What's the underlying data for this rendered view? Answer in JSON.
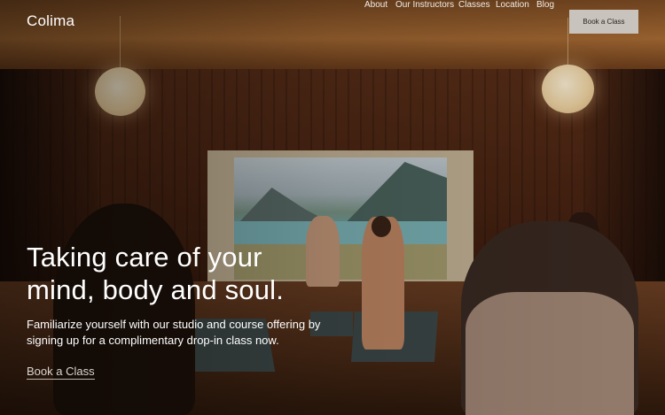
{
  "brand": {
    "logo_text": "Colima"
  },
  "nav": {
    "items": [
      {
        "label": "About"
      },
      {
        "label": "Our Instructors"
      },
      {
        "label": "Classes"
      },
      {
        "label": "Location"
      },
      {
        "label": "Blog"
      }
    ],
    "cta_label": "Book a Class"
  },
  "hero": {
    "headline": "Taking care of your mind, body and soul.",
    "subtext": "Familiarize yourself with our studio and course offering by signing up for a complimentary drop-in class now.",
    "link_label": "Book a Class"
  },
  "colors": {
    "cta_background": "#c9c3bd",
    "text": "#ffffff"
  }
}
